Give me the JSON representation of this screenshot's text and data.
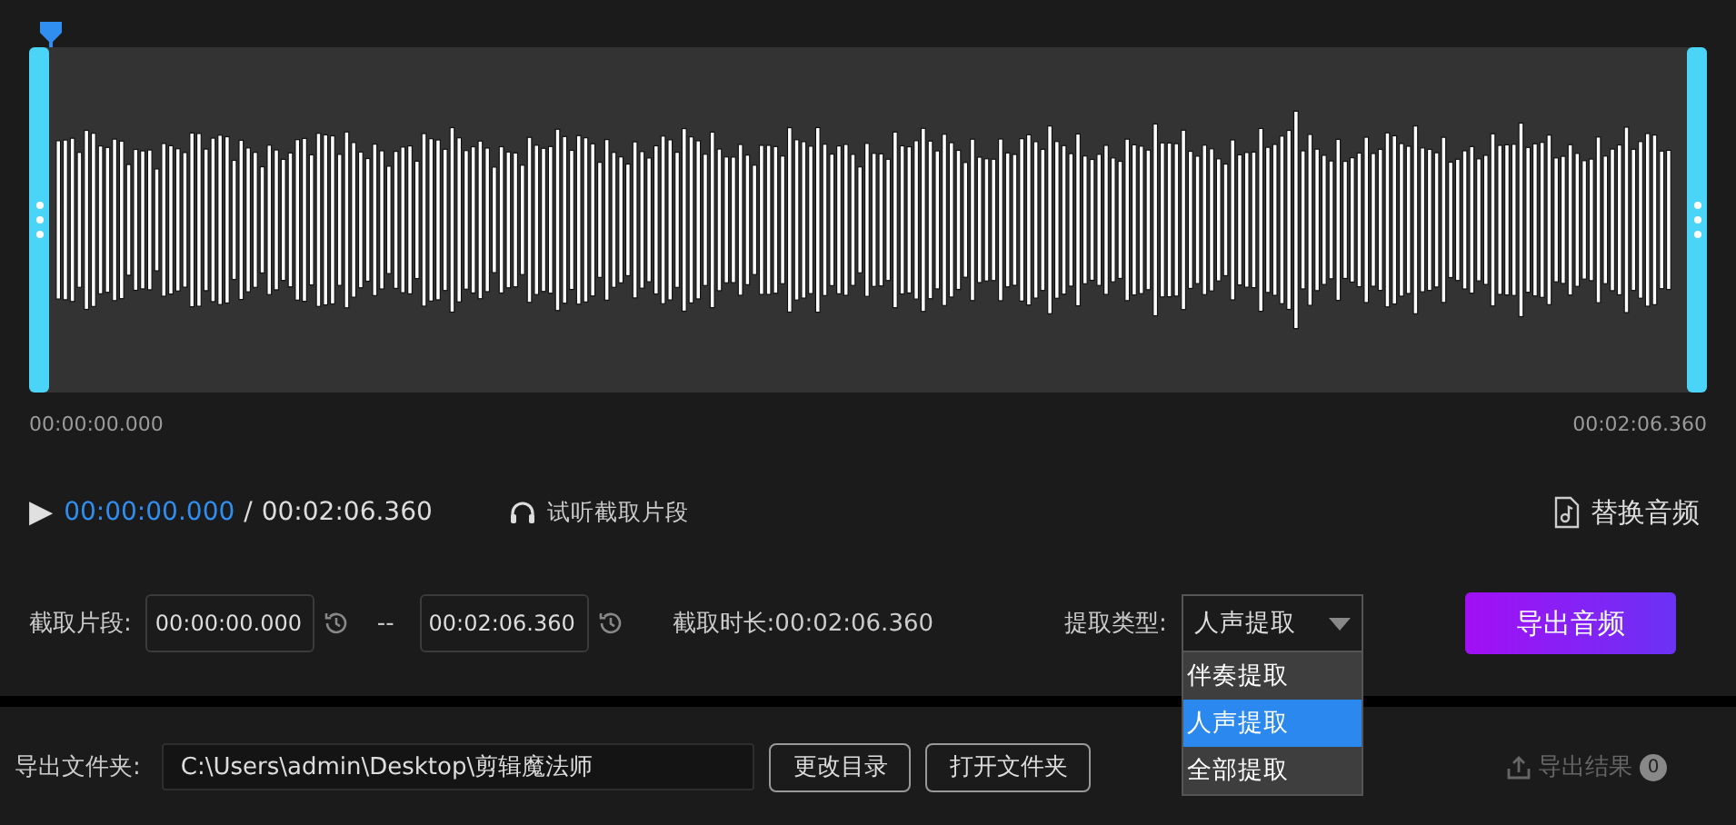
{
  "timeline": {
    "start_label": "00:00:00.000",
    "end_label": "00:02:06.360"
  },
  "player": {
    "play_icon": "▶",
    "current": "00:00:00.000",
    "separator": "/",
    "total": "00:02:06.360",
    "preview_label": "试听截取片段",
    "replace_label": "替换音频"
  },
  "clip": {
    "label": "截取片段:",
    "start": "00:00:00.000",
    "dash": "--",
    "end": "00:02:06.360",
    "duration_label": "截取时长:",
    "duration": "00:02:06.360"
  },
  "extract_type": {
    "label": "提取类型:",
    "value": "人声提取",
    "expanded": true,
    "options": [
      {
        "label": "伴奏提取",
        "selected": false
      },
      {
        "label": "人声提取",
        "selected": true
      },
      {
        "label": "全部提取",
        "selected": false
      }
    ]
  },
  "export_button": "导出音频",
  "footer": {
    "folder_label": "导出文件夹:",
    "folder_path": "C:\\Users\\admin\\Desktop\\剪辑魔法师",
    "change_button": "更改目录",
    "open_button": "打开文件夹",
    "results_label": "导出结果",
    "results_count": "0"
  }
}
